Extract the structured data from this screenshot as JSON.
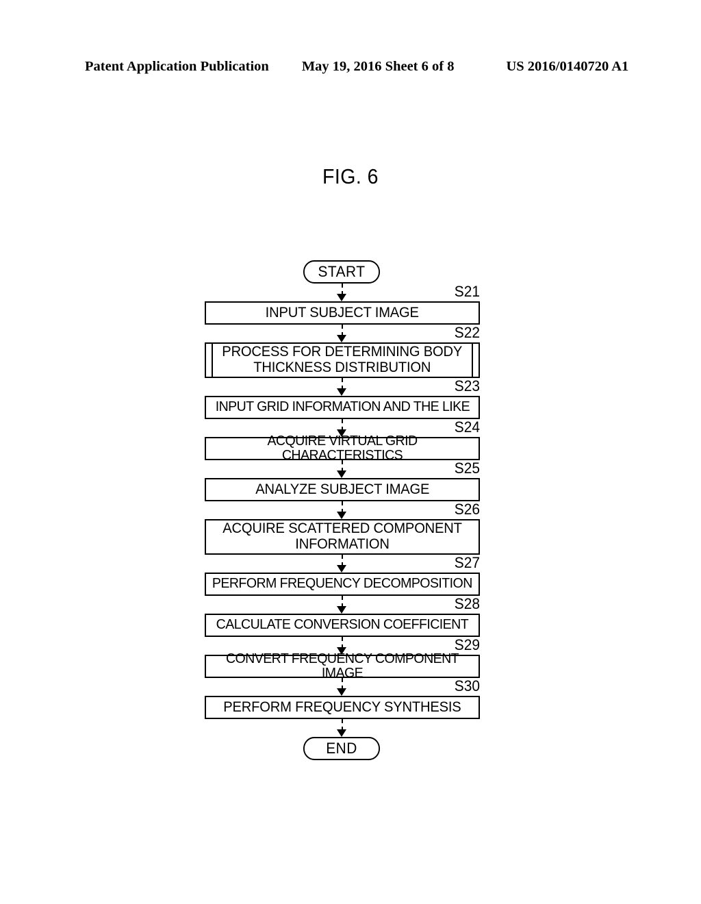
{
  "header": {
    "publication": "Patent Application Publication",
    "date_sheet": "May 19, 2016  Sheet 6 of 8",
    "patent_number": "US 2016/0140720 A1"
  },
  "figure": {
    "title": "FIG. 6"
  },
  "flowchart": {
    "type": "flowchart",
    "orientation": "vertical",
    "start_label": "START",
    "end_label": "END",
    "connector_style": "dashed-line-with-solid-arrowhead",
    "steps": [
      {
        "id": "S21",
        "text": "INPUT SUBJECT IMAGE",
        "shape": "process",
        "lines": 1
      },
      {
        "id": "S22",
        "text": "PROCESS FOR DETERMINING BODY\nTHICKNESS DISTRIBUTION",
        "shape": "predefined-process",
        "lines": 2
      },
      {
        "id": "S23",
        "text": "INPUT GRID INFORMATION AND THE LIKE",
        "shape": "process",
        "lines": 1
      },
      {
        "id": "S24",
        "text": "ACQUIRE VIRTUAL GRID CHARACTERISTICS",
        "shape": "process",
        "lines": 1
      },
      {
        "id": "S25",
        "text": "ANALYZE SUBJECT IMAGE",
        "shape": "process",
        "lines": 1
      },
      {
        "id": "S26",
        "text": "ACQUIRE SCATTERED COMPONENT\nINFORMATION",
        "shape": "process",
        "lines": 2
      },
      {
        "id": "S27",
        "text": "PERFORM FREQUENCY DECOMPOSITION",
        "shape": "process",
        "lines": 1
      },
      {
        "id": "S28",
        "text": "CALCULATE CONVERSION COEFFICIENT",
        "shape": "process",
        "lines": 1
      },
      {
        "id": "S29",
        "text": "CONVERT FREQUENCY COMPONENT IMAGE",
        "shape": "process",
        "lines": 1
      },
      {
        "id": "S30",
        "text": "PERFORM FREQUENCY SYNTHESIS",
        "shape": "process",
        "lines": 1
      }
    ]
  },
  "colors": {
    "ink": "#000000",
    "paper": "#ffffff"
  }
}
